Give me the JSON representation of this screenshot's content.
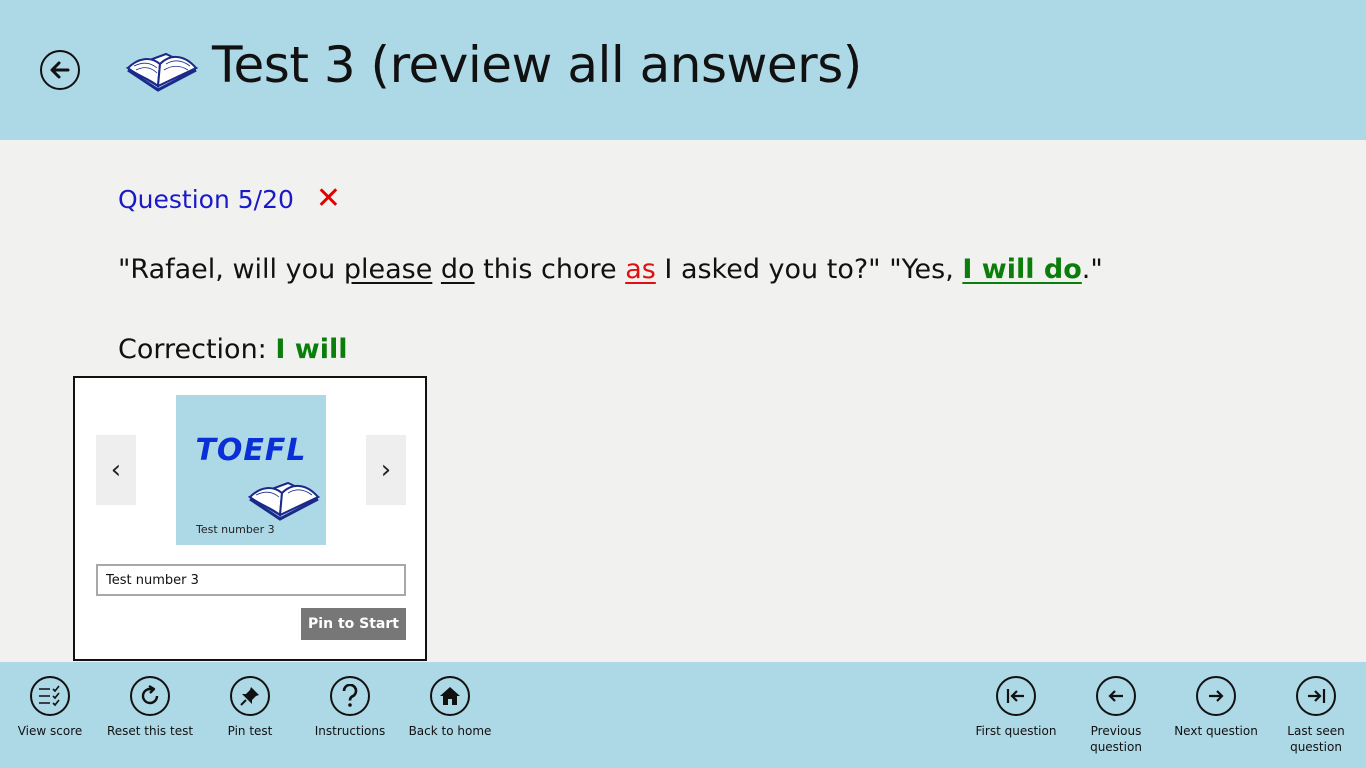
{
  "header": {
    "title": "Test 3 (review all answers)",
    "back_icon": "arrow-left-icon",
    "book_icon": "open-book-icon"
  },
  "question": {
    "label": "Question 5/20",
    "status_mark": "✕",
    "status": "incorrect",
    "sentence": {
      "p1": "\"Rafael, will you ",
      "u1": "please",
      "p2": " ",
      "u2": "do",
      "p3": " this chore ",
      "u3_wrong": "as",
      "p4": " I asked you to?\" \"Yes, ",
      "u4_right": "I will do",
      "p5": ".\""
    },
    "correction_label": "Correction: ",
    "correction_value": "I will"
  },
  "pin_popup": {
    "prev_label": "‹",
    "next_label": "›",
    "tile_logo": "TOEFL",
    "tile_caption": "Test number 3",
    "tile_name_value": "Test number 3",
    "pin_button_label": "Pin to Start"
  },
  "appbar": {
    "left": [
      {
        "label": "View score",
        "icon": "checklist-icon"
      },
      {
        "label": "Reset this test",
        "icon": "refresh-icon"
      },
      {
        "label": "Pin test",
        "icon": "pin-icon"
      },
      {
        "label": "Instructions",
        "icon": "question-icon"
      },
      {
        "label": "Back to home",
        "icon": "home-icon"
      }
    ],
    "right": [
      {
        "label": "First question",
        "icon": "first-icon"
      },
      {
        "label": "Previous question",
        "icon": "previous-icon"
      },
      {
        "label": "Next question",
        "icon": "next-icon"
      },
      {
        "label": "Last seen question",
        "icon": "last-icon"
      }
    ]
  },
  "colors": {
    "header_bg": "#add8e6",
    "question_blue": "#1a1ac8",
    "wrong_red": "#e01010",
    "correct_green": "#0a7d0a"
  }
}
